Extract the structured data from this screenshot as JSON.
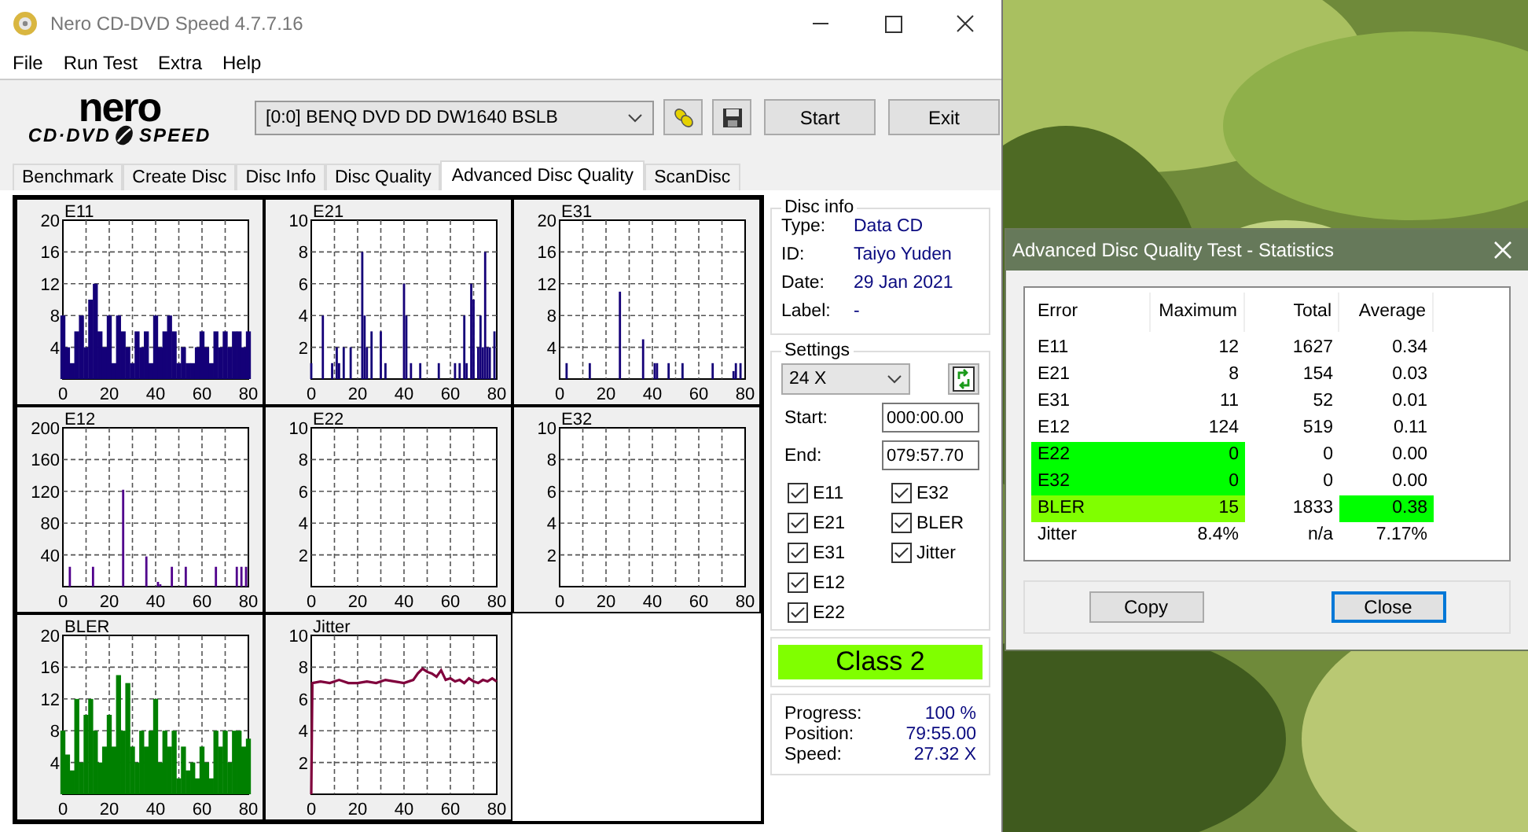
{
  "window": {
    "title": "Nero CD-DVD Speed 4.7.7.16"
  },
  "menu": [
    "File",
    "Run Test",
    "Extra",
    "Help"
  ],
  "logo": {
    "brand": "nero",
    "left": "CD·DVD",
    "right": "SPEED"
  },
  "toolbar": {
    "drive": "[0:0]  BENQ DVD DD DW1640 BSLB",
    "buttons": [
      "Start",
      "Exit"
    ]
  },
  "tabs": [
    {
      "label": "Benchmark",
      "selected": false
    },
    {
      "label": "Create Disc",
      "selected": false
    },
    {
      "label": "Disc Info",
      "selected": false
    },
    {
      "label": "Disc Quality",
      "selected": false
    },
    {
      "label": "Advanced Disc Quality",
      "selected": true
    },
    {
      "label": "ScanDisc",
      "selected": false
    }
  ],
  "charts": [
    {
      "chart_data": {
        "type": "bar",
        "title": "E11",
        "grid": true,
        "xlim": [
          0,
          80
        ],
        "ylim": [
          0,
          20
        ],
        "xticks": [
          0,
          20,
          40,
          60,
          80
        ],
        "yticks": [
          4,
          8,
          12,
          16,
          20
        ],
        "x": [
          0,
          2,
          4,
          6,
          8,
          10,
          12,
          14,
          16,
          18,
          20,
          22,
          24,
          26,
          28,
          30,
          32,
          34,
          36,
          38,
          40,
          42,
          44,
          46,
          48,
          50,
          52,
          54,
          56,
          58,
          60,
          62,
          64,
          66,
          68,
          70,
          72,
          74,
          76,
          78,
          80
        ],
        "series": [
          {
            "color": "#140078",
            "values": [
              8,
              4,
              2,
              6,
              8,
              4,
              10,
              12,
              6,
              4,
              8,
              2,
              8,
              6,
              4,
              2,
              6,
              4,
              6,
              2,
              8,
              4,
              6,
              8,
              6,
              2,
              4,
              2,
              2,
              4,
              6,
              4,
              2,
              6,
              4,
              6,
              4,
              6,
              6,
              4,
              6
            ]
          }
        ]
      }
    },
    {
      "chart_data": {
        "type": "bar",
        "title": "E21",
        "grid": true,
        "xlim": [
          0,
          80
        ],
        "ylim": [
          0,
          10
        ],
        "xticks": [
          0,
          20,
          40,
          60,
          80
        ],
        "yticks": [
          2,
          4,
          6,
          8,
          10
        ],
        "x": [
          0,
          5,
          9,
          11,
          12,
          14,
          17,
          22,
          23,
          24,
          26,
          30,
          32,
          40,
          41,
          43,
          47,
          55,
          62,
          64,
          66,
          67,
          69,
          70,
          72,
          73,
          74,
          75,
          76,
          77,
          79
        ],
        "series": [
          {
            "color": "#140078",
            "values": [
              1,
              4,
              1,
              2,
              1,
              2,
              2,
              8,
              4,
              2,
              3,
              3,
              1,
              6,
              4,
              1,
              1,
              1,
              1,
              1,
              4,
              1,
              6,
              5,
              2,
              4,
              2,
              8,
              2,
              2,
              3
            ]
          }
        ]
      }
    },
    {
      "chart_data": {
        "type": "bar",
        "title": "E31",
        "grid": true,
        "xlim": [
          0,
          80
        ],
        "ylim": [
          0,
          20
        ],
        "xticks": [
          0,
          20,
          40,
          60,
          80
        ],
        "yticks": [
          4,
          8,
          12,
          16,
          20
        ],
        "x": [
          3,
          13,
          26,
          36,
          41,
          42,
          47,
          53,
          66,
          75,
          76,
          78
        ],
        "series": [
          {
            "color": "#140078",
            "values": [
              2,
              2,
              11,
              5,
              2,
              2,
              2,
              2,
              2,
              1,
              2,
              2
            ]
          }
        ]
      }
    },
    {
      "chart_data": {
        "type": "bar",
        "title": "E12",
        "grid": true,
        "xlim": [
          0,
          80
        ],
        "ylim": [
          0,
          200
        ],
        "xticks": [
          0,
          20,
          40,
          60,
          80
        ],
        "yticks": [
          40,
          80,
          120,
          160,
          200
        ],
        "x": [
          3,
          13,
          26,
          36,
          41,
          42,
          47,
          53,
          66,
          75,
          77,
          79
        ],
        "series": [
          {
            "color": "#50008c",
            "values": [
              25,
              25,
              122,
              38,
              6,
              3,
              25,
              25,
              25,
              25,
              25,
              25
            ]
          }
        ]
      }
    },
    {
      "chart_data": {
        "type": "bar",
        "title": "E22",
        "grid": true,
        "xlim": [
          0,
          80
        ],
        "ylim": [
          0,
          10
        ],
        "xticks": [
          0,
          20,
          40,
          60,
          80
        ],
        "yticks": [
          2,
          4,
          6,
          8,
          10
        ]
      }
    },
    {
      "chart_data": {
        "type": "bar",
        "title": "E32",
        "grid": true,
        "xlim": [
          0,
          80
        ],
        "ylim": [
          0,
          10
        ],
        "xticks": [
          0,
          20,
          40,
          60,
          80
        ],
        "yticks": [
          2,
          4,
          6,
          8,
          10
        ]
      }
    },
    {
      "chart_data": {
        "type": "bar",
        "title": "BLER",
        "grid": true,
        "xlim": [
          0,
          80
        ],
        "ylim": [
          0,
          20
        ],
        "xticks": [
          0,
          20,
          40,
          60,
          80
        ],
        "yticks": [
          4,
          8,
          12,
          16,
          20
        ],
        "x": [
          0,
          2,
          4,
          6,
          8,
          10,
          12,
          14,
          16,
          18,
          20,
          22,
          24,
          26,
          28,
          30,
          32,
          34,
          36,
          38,
          40,
          42,
          44,
          46,
          48,
          50,
          52,
          54,
          56,
          58,
          60,
          62,
          64,
          66,
          68,
          70,
          72,
          74,
          76,
          78,
          80
        ],
        "series": [
          {
            "color": "#008000",
            "values": [
              8,
              5,
              3,
              12,
              4,
              10,
              12,
              8,
              4,
              6,
              10,
              6,
              15,
              8,
              14,
              6,
              4,
              8,
              6,
              8,
              12,
              4,
              8,
              6,
              8,
              2,
              6,
              3,
              4,
              2,
              6,
              4,
              2,
              8,
              6,
              8,
              4,
              8,
              8,
              6,
              7
            ]
          }
        ]
      }
    },
    {
      "chart_data": {
        "type": "line",
        "title": "Jitter",
        "grid": true,
        "xlim": [
          0,
          80
        ],
        "ylim": [
          0,
          10
        ],
        "xticks": [
          0,
          20,
          40,
          60,
          80
        ],
        "yticks": [
          2,
          4,
          6,
          8,
          10
        ],
        "x": [
          0,
          0.5,
          4,
          8,
          12,
          16,
          20,
          24,
          28,
          32,
          36,
          40,
          44,
          46,
          48,
          50,
          52,
          54,
          56,
          58,
          60,
          62,
          64,
          66,
          68,
          70,
          72,
          74,
          76,
          78,
          80
        ],
        "series": [
          {
            "color": "#80003c",
            "values": [
              0,
              7,
              7.1,
              7,
              7.2,
              7,
              7,
              7.1,
              7,
              7.2,
              7.1,
              7,
              7.2,
              7.6,
              7.9,
              7.7,
              7.6,
              7.4,
              7.8,
              7.2,
              7.3,
              7.1,
              7.2,
              7,
              7.3,
              7.1,
              7,
              7.2,
              7.1,
              7.3,
              7.1
            ]
          }
        ]
      }
    }
  ],
  "disc_info": {
    "title": "Disc info",
    "fields": [
      {
        "label": "Type:",
        "value": "Data CD"
      },
      {
        "label": "ID:",
        "value": "Taiyo Yuden"
      },
      {
        "label": "Date:",
        "value": "29 Jan 2021"
      },
      {
        "label": "Label:",
        "value": "-"
      }
    ]
  },
  "settings": {
    "title": "Settings",
    "speed": "24 X",
    "start_label": "Start:",
    "start": "000:00.00",
    "end_label": "End:",
    "end": "079:57.70",
    "checks_left": [
      {
        "label": "E11",
        "checked": true
      },
      {
        "label": "E21",
        "checked": true
      },
      {
        "label": "E31",
        "checked": true
      },
      {
        "label": "E12",
        "checked": true
      },
      {
        "label": "E22",
        "checked": true
      }
    ],
    "checks_right": [
      {
        "label": "E32",
        "checked": true
      },
      {
        "label": "BLER",
        "checked": true
      },
      {
        "label": "Jitter",
        "checked": true
      }
    ]
  },
  "class_badge": {
    "text": "Class 2",
    "color": "#80ff00"
  },
  "progress": [
    {
      "label": "Progress:",
      "value": "100 %"
    },
    {
      "label": "Position:",
      "value": "79:55.00"
    },
    {
      "label": "Speed:",
      "value": "27.32 X"
    }
  ],
  "dialog": {
    "title": "Advanced Disc Quality Test - Statistics",
    "columns": [
      "Error",
      "Maximum",
      "Total",
      "Average"
    ],
    "rows": [
      {
        "cells": [
          {
            "text": "E11"
          },
          {
            "text": "12"
          },
          {
            "text": "1627"
          },
          {
            "text": "0.34"
          }
        ]
      },
      {
        "cells": [
          {
            "text": "E21"
          },
          {
            "text": "8"
          },
          {
            "text": "154"
          },
          {
            "text": "0.03"
          }
        ]
      },
      {
        "cells": [
          {
            "text": "E31"
          },
          {
            "text": "11"
          },
          {
            "text": "52"
          },
          {
            "text": "0.01"
          }
        ]
      },
      {
        "cells": [
          {
            "text": "E12"
          },
          {
            "text": "124"
          },
          {
            "text": "519"
          },
          {
            "text": "0.11"
          }
        ]
      },
      {
        "cells": [
          {
            "text": "E22",
            "color": "#00ff00"
          },
          {
            "text": "0",
            "color": "#00ff00"
          },
          {
            "text": "0"
          },
          {
            "text": "0.00"
          }
        ]
      },
      {
        "cells": [
          {
            "text": "E32",
            "color": "#00ff00"
          },
          {
            "text": "0",
            "color": "#00ff00"
          },
          {
            "text": "0"
          },
          {
            "text": "0.00"
          }
        ]
      },
      {
        "cells": [
          {
            "text": "BLER",
            "color": "#80ff00"
          },
          {
            "text": "15",
            "color": "#80ff00"
          },
          {
            "text": "1833"
          },
          {
            "text": "0.38",
            "color": "#00ff00"
          }
        ]
      },
      {
        "cells": [
          {
            "text": "Jitter"
          },
          {
            "text": "8.4%"
          },
          {
            "text": "n/a"
          },
          {
            "text": "7.17%"
          }
        ]
      }
    ],
    "buttons": [
      {
        "label": "Copy",
        "default": false
      },
      {
        "label": "Close",
        "default": true
      }
    ]
  }
}
